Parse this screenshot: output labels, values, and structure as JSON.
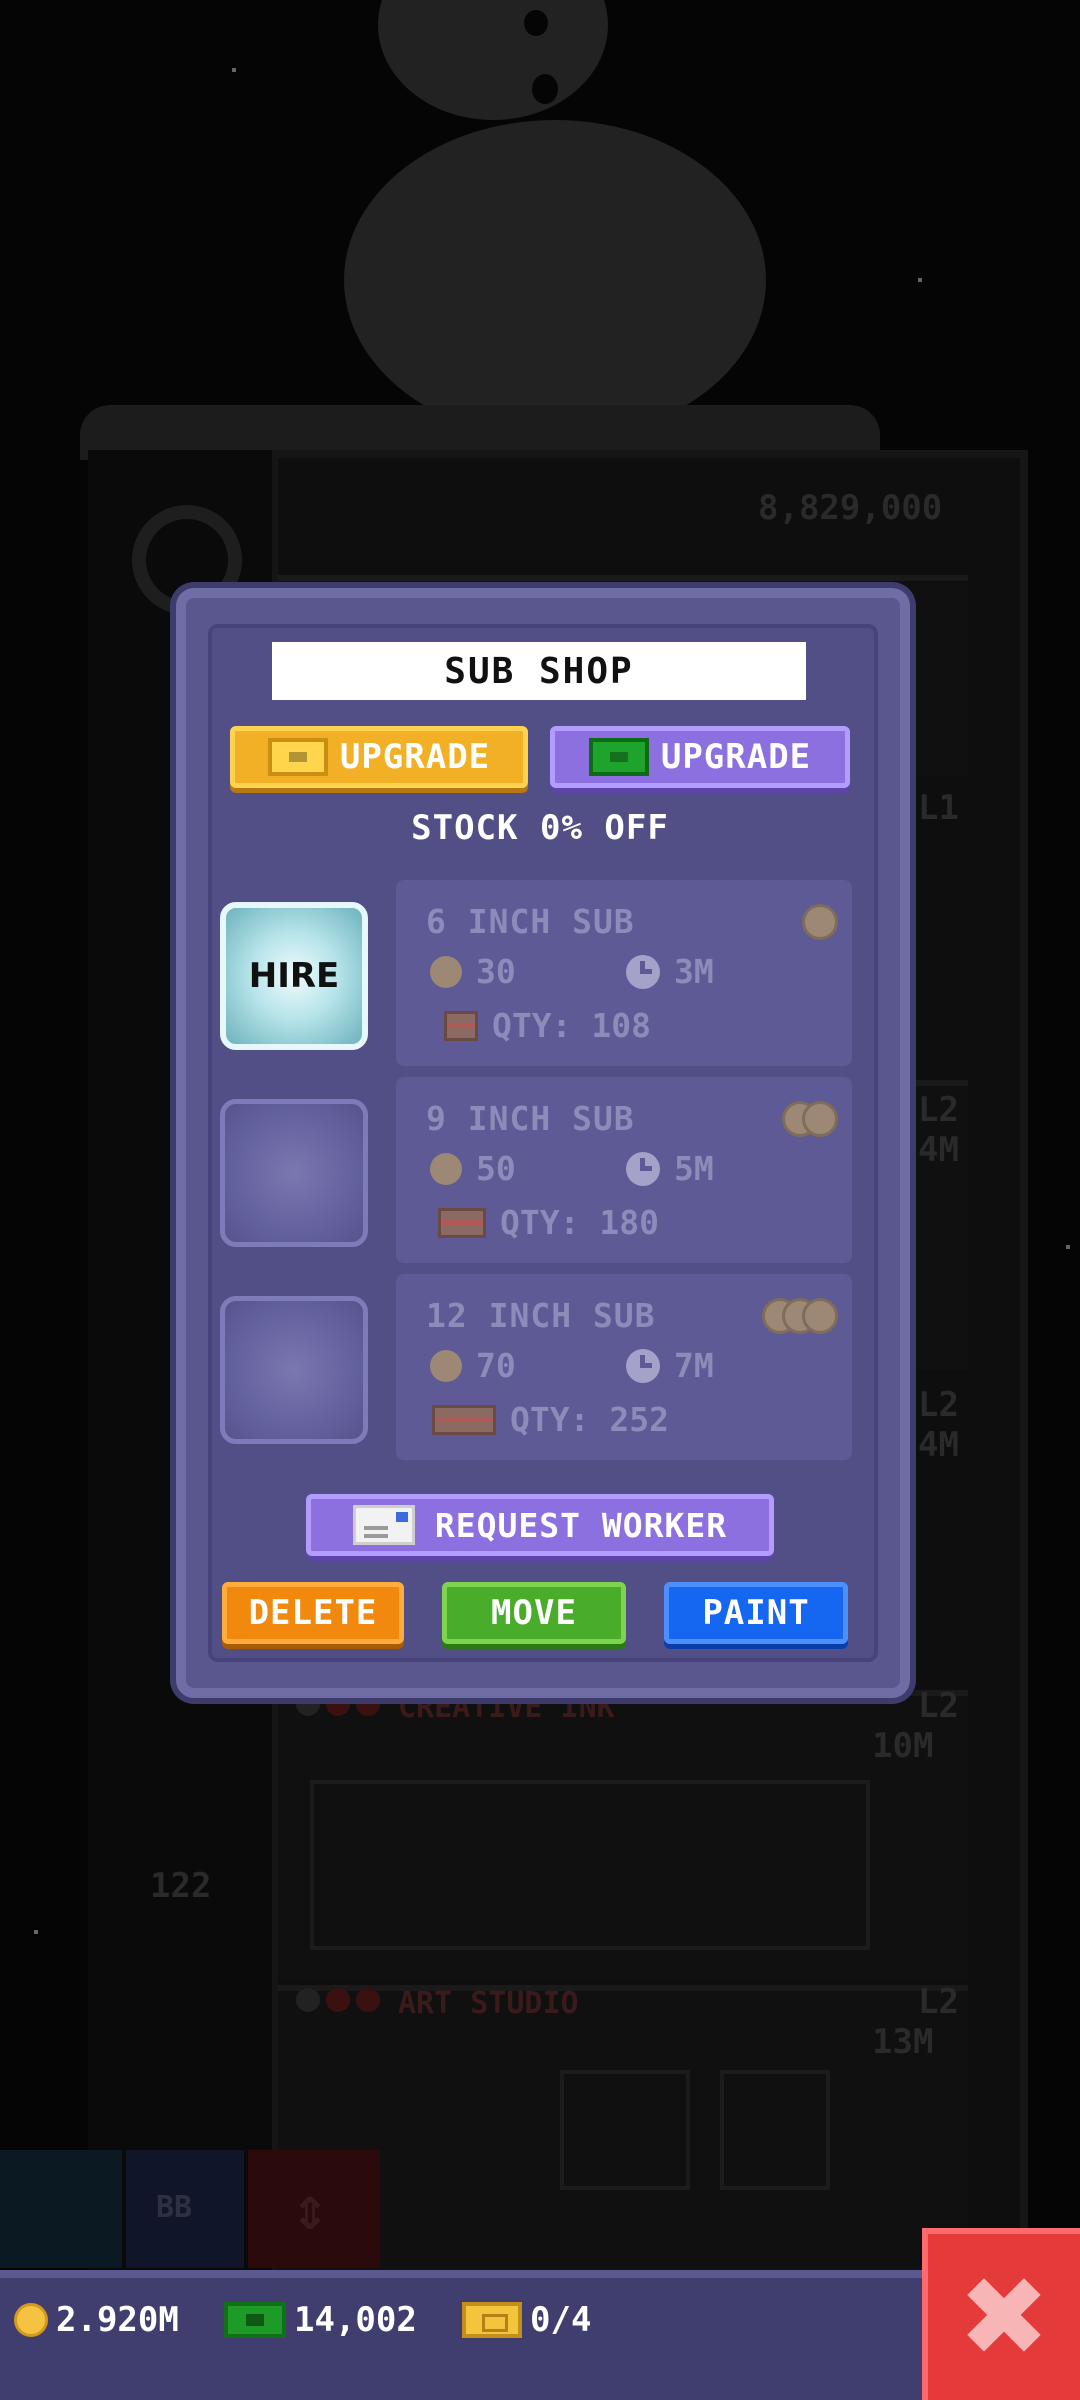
{
  "modal": {
    "title": "SUB SHOP",
    "upgrade_gold_label": "UPGRADE",
    "upgrade_bux_label": "UPGRADE",
    "stock_discount": "STOCK 0% OFF",
    "hire_label": "HIRE",
    "products": [
      {
        "name": "6 INCH SUB",
        "cost": "30",
        "time": "3M",
        "qty": "QTY: 108",
        "tier": 1
      },
      {
        "name": "9 INCH SUB",
        "cost": "50",
        "time": "5M",
        "qty": "QTY: 180",
        "tier": 2
      },
      {
        "name": "12 INCH SUB",
        "cost": "70",
        "time": "7M",
        "qty": "QTY: 252",
        "tier": 3
      }
    ],
    "request_worker_label": "REQUEST WORKER",
    "actions": {
      "delete": "DELETE",
      "move": "MOVE",
      "paint": "PAINT"
    }
  },
  "status_bar": {
    "coins": "2.920M",
    "bux": "14,002",
    "tickets": "0/4"
  },
  "background": {
    "top_value": "8,829,000",
    "floor_creative": "CREATIVE INK",
    "floor_art": "ART STUDIO",
    "floor_level_l1": "L1",
    "floor_level_l2": "L2",
    "value_10m": "10M",
    "value_13m": "13M",
    "value_4m": "4M",
    "floor_num_122": "122",
    "toolbar_bb": "BB"
  },
  "icons": {
    "coin": "coin-icon",
    "bux": "bux-icon",
    "ticket": "golden-ticket-icon",
    "clock": "clock-icon",
    "crate": "crate-icon",
    "mail": "mail-icon",
    "close": "close-icon"
  },
  "colors": {
    "modal_bg": "#59578e",
    "gold": "#f2b027",
    "purple": "#8d70e0",
    "delete": "#f2890f",
    "move": "#4aac2b",
    "paint": "#1566f0",
    "close": "#e53a3a"
  }
}
